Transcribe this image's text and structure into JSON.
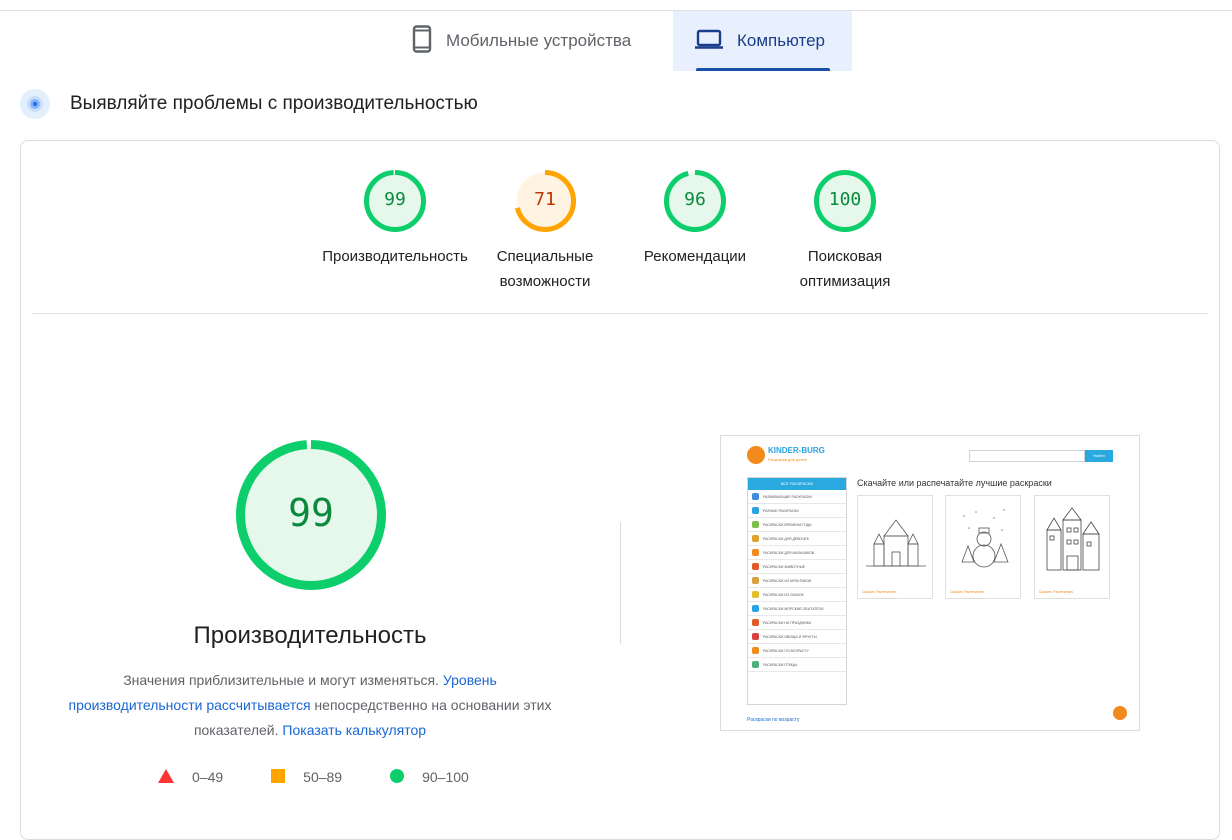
{
  "tabs": {
    "mobile_label": "Мобильные устройства",
    "desktop_label": "Компьютер"
  },
  "section": {
    "title": "Выявляйте проблемы с производительностью"
  },
  "categories": [
    {
      "score": "99",
      "label": "Производительность",
      "status": "pass",
      "color": "#0cce6b",
      "text_color": "#0a8a3c",
      "fraction": 0.99
    },
    {
      "score": "71",
      "label": "Специальные возможности",
      "status": "average",
      "color": "#ffa400",
      "text_color": "#c33300",
      "fraction": 0.71
    },
    {
      "score": "96",
      "label": "Рекомендации",
      "status": "pass",
      "color": "#0cce6b",
      "text_color": "#0a8a3c",
      "fraction": 0.96
    },
    {
      "score": "100",
      "label": "Поисковая оптимизация",
      "status": "pass",
      "color": "#0cce6b",
      "text_color": "#0a8a3c",
      "fraction": 1.0
    }
  ],
  "performance": {
    "score": "99",
    "fraction": 0.99,
    "title": "Производительность",
    "desc_plain_1": "Значения приблизительные и могут изменяться. ",
    "desc_link_1": "Уровень производительности рассчитывается",
    "desc_plain_2": " непосредственно на основании этих показателей. ",
    "desc_link_2": "Показать калькулятор"
  },
  "legend": [
    {
      "range": "0–49",
      "shape": "triangle",
      "color": "#ff3333"
    },
    {
      "range": "50–89",
      "shape": "square",
      "color": "#ffa400"
    },
    {
      "range": "90–100",
      "shape": "circle",
      "color": "#0cce6b"
    }
  ],
  "screenshot": {
    "brand": "KINDER-BURG",
    "brand_sub": "Раскраски для детей",
    "search_button": "Найти",
    "sidebar_head": "ВСЕ РАСКРАСКИ",
    "sidebar_items": [
      "РАЗВИВАЮЩИЕ РАСКРАСКИ",
      "РАЗНЫЕ РАСКРАСКИ",
      "РАСКРАСКИ ВРЕМЕНА ГОДА",
      "РАСКРАСКИ ДЛЯ ДЕВОЧЕК",
      "РАСКРАСКИ ДЛЯ МАЛЬЧИКОВ",
      "РАСКРАСКИ ЖИВОТНЫЕ",
      "РАСКРАСКИ ИЗ МУЛЬТИКОВ",
      "РАСКРАСКИ ИЗ СКАЗОК",
      "РАСКРАСКИ МОРСКИЕ ОБИТАТЕЛИ",
      "РАСКРАСКИ НА ПРАЗДНИКИ",
      "РАСКРАСКИ ОВОЩИ И ФРУКТЫ",
      "РАСКРАСКИ ПО ВОЗРАСТУ",
      "РАСКРАСКИ ПТИЦЫ"
    ],
    "headline": "Скачайте или распечатайте лучшие раскраски",
    "thumb_actions": "Скачать  Распечатать",
    "footer_link": "Раскраски по возрасту"
  }
}
